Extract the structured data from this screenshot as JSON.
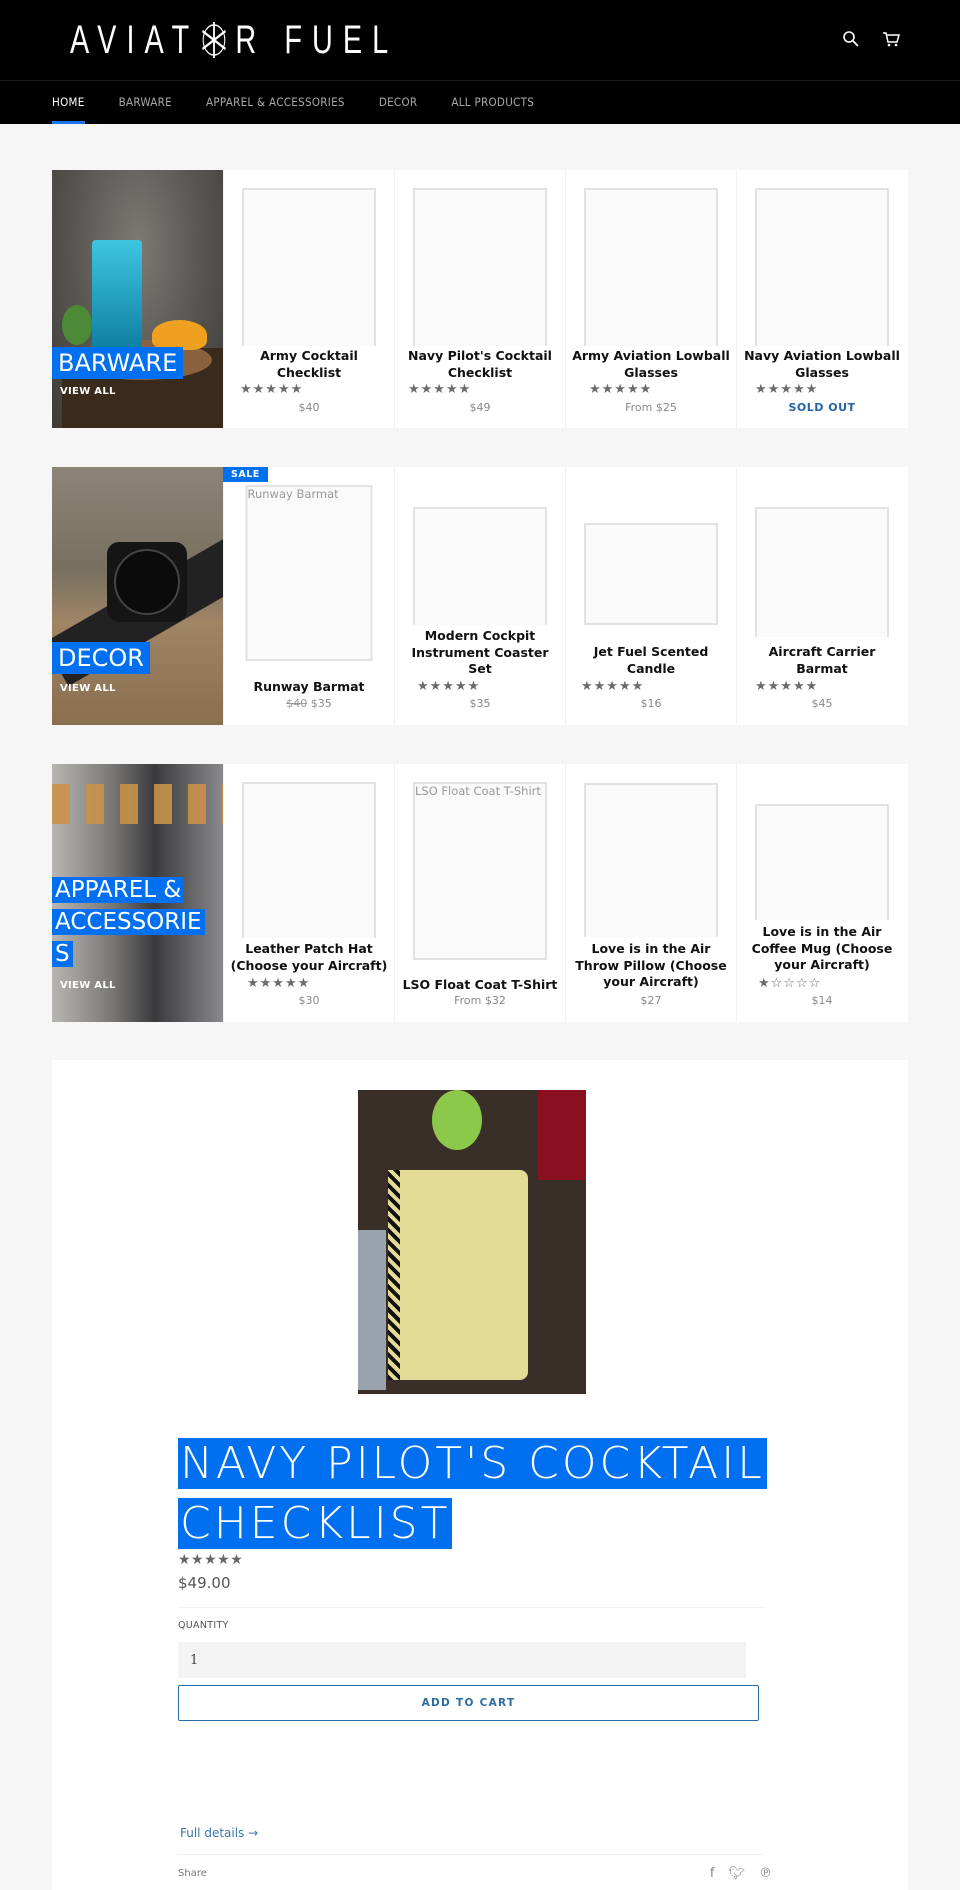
{
  "header": {
    "logo_text": "AVIATOR FUEL",
    "icons": {
      "search": "search-icon",
      "cart": "cart-icon"
    }
  },
  "nav": {
    "items": [
      {
        "label": "HOME",
        "active": true
      },
      {
        "label": "BARWARE",
        "active": false
      },
      {
        "label": "APPAREL & ACCESSORIES",
        "active": false
      },
      {
        "label": "DECOR",
        "active": false
      },
      {
        "label": "ALL PRODUCTS",
        "active": false
      }
    ]
  },
  "collections": [
    {
      "title": "BARWARE",
      "view_all": "VIEW ALL",
      "products": [
        {
          "name": "Army Cocktail Checklist",
          "rating": 5,
          "price": "$40"
        },
        {
          "name": "Navy Pilot's Cocktail Checklist",
          "rating": 5,
          "price": "$49"
        },
        {
          "name": "Army Aviation Lowball Glasses",
          "rating": 5,
          "price": "From $25"
        },
        {
          "name": "Navy Aviation Lowball Glasses",
          "rating": 5,
          "price": "SOLD OUT"
        }
      ]
    },
    {
      "title": "DECOR",
      "view_all": "VIEW ALL",
      "products": [
        {
          "name": "Runway Barmat",
          "badge": "SALE",
          "image_alt": "Runway Barmat",
          "rating": null,
          "compare_price": "$40",
          "price": "$35"
        },
        {
          "name": "Modern Cockpit Instrument Coaster Set",
          "rating": 5,
          "price": "$35"
        },
        {
          "name": "Jet Fuel Scented Candle",
          "rating": 5,
          "price": "$16"
        },
        {
          "name": "Aircraft Carrier Barmat",
          "rating": 5,
          "price": "$45"
        }
      ]
    },
    {
      "title": "APPAREL & ACCESSORIES",
      "view_all": "VIEW ALL",
      "products": [
        {
          "name": "Leather Patch Hat (Choose your Aircraft)",
          "rating": 5,
          "price": "$30"
        },
        {
          "name": "LSO Float Coat T-Shirt",
          "image_alt": "LSO Float Coat T-Shirt",
          "rating": null,
          "price": "From $32"
        },
        {
          "name": "Love is in the Air Throw Pillow (Choose your Aircraft)",
          "rating": null,
          "price": "$27"
        },
        {
          "name": "Love is in the Air Coffee Mug (Choose your Aircraft)",
          "rating": 1,
          "price": "$14"
        }
      ]
    }
  ],
  "featured_product": {
    "title": "NAVY PILOT'S COCKTAIL CHECKLIST",
    "rating": 5,
    "price": "$49.00",
    "quantity_label": "QUANTITY",
    "quantity_value": "1",
    "add_to_cart": "ADD TO CART",
    "full_details": "Full details →",
    "share_label": "Share",
    "social": [
      "facebook-icon",
      "twitter-icon",
      "pinterest-icon"
    ]
  },
  "colors": {
    "accent": "#0070f0",
    "link": "#2b6ca3",
    "nav_bg": "#000000"
  }
}
